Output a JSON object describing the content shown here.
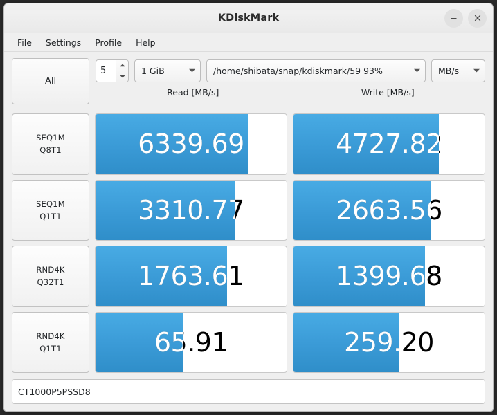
{
  "window": {
    "title": "KDiskMark",
    "minimize_label": "–",
    "close_label": "×"
  },
  "menu": {
    "items": [
      {
        "label": "File"
      },
      {
        "label": "Settings"
      },
      {
        "label": "Profile"
      },
      {
        "label": "Help"
      }
    ]
  },
  "toolbar": {
    "all_button": "All",
    "loops": "5",
    "size": "1 GiB",
    "path": "/home/shibata/snap/kdiskmark/59 93%",
    "unit": "MB/s"
  },
  "headers": {
    "read": "Read [MB/s]",
    "write": "Write [MB/s]"
  },
  "results": {
    "rows": [
      {
        "name_line1": "SEQ1M",
        "name_line2": "Q8T1",
        "read": "6339.69",
        "read_fill": 80,
        "write": "4727.82",
        "write_fill": 76
      },
      {
        "name_line1": "SEQ1M",
        "name_line2": "Q1T1",
        "read": "3310.77",
        "read_fill": 73,
        "write": "2663.56",
        "write_fill": 72
      },
      {
        "name_line1": "RND4K",
        "name_line2": "Q32T1",
        "read": "1763.61",
        "read_fill": 69,
        "write": "1399.68",
        "write_fill": 69
      },
      {
        "name_line1": "RND4K",
        "name_line2": "Q1T1",
        "read": "65.91",
        "read_fill": 46,
        "write": "259.20",
        "write_fill": 55
      }
    ]
  },
  "drive": {
    "model": "CT1000P5PSSD8"
  },
  "colors": {
    "bar_fill": "#3a9ad6",
    "window_bg": "#efefef",
    "text": "#232629"
  }
}
